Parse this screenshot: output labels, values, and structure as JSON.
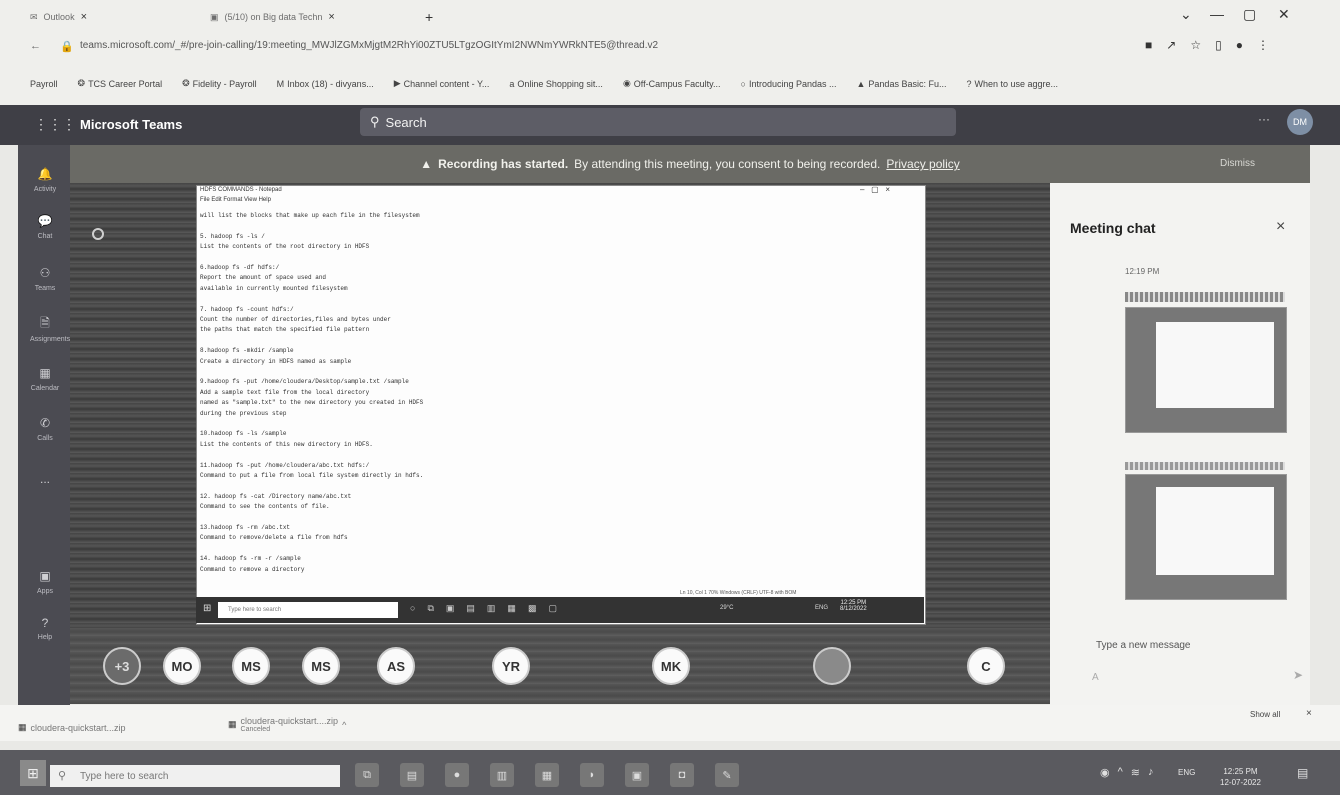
{
  "browser": {
    "tabs": [
      {
        "label": "Outlook",
        "icon": "outlook-icon"
      },
      {
        "label": "(5/10) on Big data Techn",
        "icon": "teams-icon"
      }
    ],
    "new_tab": "+",
    "window_controls": [
      "⌄",
      "—",
      "▢",
      "✕"
    ],
    "address": "teams.microsoft.com/_#/pre-join-calling/19:meeting_MWJlZGMxMjgtM2RhYi00ZTU5LTgzOGItYmI2NWNmYWRkNTE5@thread.v2",
    "bookmarks": [
      "Payroll",
      "TCS Career Portal",
      "Fidelity - Payroll",
      "Inbox (18) - divyans...",
      "Channel content - Y...",
      "Online Shopping sit...",
      "Off-Campus Faculty...",
      "Introducing Pandas ...",
      "Pandas Basic: Fu...",
      "When to use aggre..."
    ]
  },
  "teams": {
    "title": "Microsoft Teams",
    "search_placeholder": "Search",
    "user_initials": "DM",
    "sidebar": [
      "Activity",
      "Chat",
      "Teams",
      "Assignments",
      "Calendar",
      "Calls",
      "...",
      "Apps",
      "Help"
    ],
    "banner": {
      "bold": "Recording has started.",
      "text": "By attending this meeting, you consent to being recorded.",
      "link": "Privacy policy",
      "dismiss": "Dismiss"
    }
  },
  "shared_screen": {
    "window_title": "HDFS COMMANDS - Notepad",
    "menu": "File  Edit  Format  View  Help",
    "lines": [
      "will list the blocks that make up each file in the filesystem",
      "",
      "5. hadoop fs -ls /",
      "List the contents of the root directory in HDFS",
      "",
      "6.hadoop fs -df hdfs:/",
      "Report the amount of space used and",
      "available in currently mounted filesystem",
      "",
      "7. hadoop fs -count hdfs:/",
      "Count the number of directories,files and bytes under",
      "the paths that match the specified file pattern",
      "",
      "8.hadoop fs -mkdir /sample",
      "Create a directory in HDFS named as sample",
      "",
      "9.hadoop fs -put /home/cloudera/Desktop/sample.txt /sample",
      "Add a sample text file from the local directory",
      "named as \"sample.txt\" to the new directory you created in HDFS",
      "during the previous step",
      "",
      "10.hadoop fs -ls /sample",
      "List the contents of this new directory in HDFS.",
      "",
      "11.hadoop fs -put /home/cloudera/abc.txt hdfs:/",
      "Command to put a file from local file system directly in hdfs.",
      "",
      "12. hadoop fs -cat /Directory name/abc.txt",
      "Command to see the contents of file.",
      "",
      "13.hadoop fs -rm /abc.txt",
      "Command to remove/delete a file from hdfs",
      "",
      "14. hadoop fs -rm -r /sample",
      "Command to remove a directory"
    ],
    "status": "Ln 10, Col 1     70%     Windows (CRLF)     UTF-8 with BOM",
    "taskbar_search": "Type here to search",
    "weather": "29°C",
    "clock": "12:25 PM",
    "date": "8/12/2022",
    "lang": "ENG"
  },
  "participants": [
    "+3",
    "MO",
    "MS",
    "MS",
    "AS",
    "YR",
    "MK",
    "",
    "C"
  ],
  "chat": {
    "title": "Meeting chat",
    "time": "12:19 PM",
    "input_placeholder": "Type a new message"
  },
  "downloads": {
    "items": [
      "cloudera-quickstart...zip",
      "cloudera-quickstart....zip"
    ],
    "item2_status": "Canceled",
    "show_all": "Show all"
  },
  "os": {
    "search_placeholder": "Type here to search",
    "lang": "ENG",
    "time": "12:25 PM",
    "date": "12-07-2022"
  }
}
